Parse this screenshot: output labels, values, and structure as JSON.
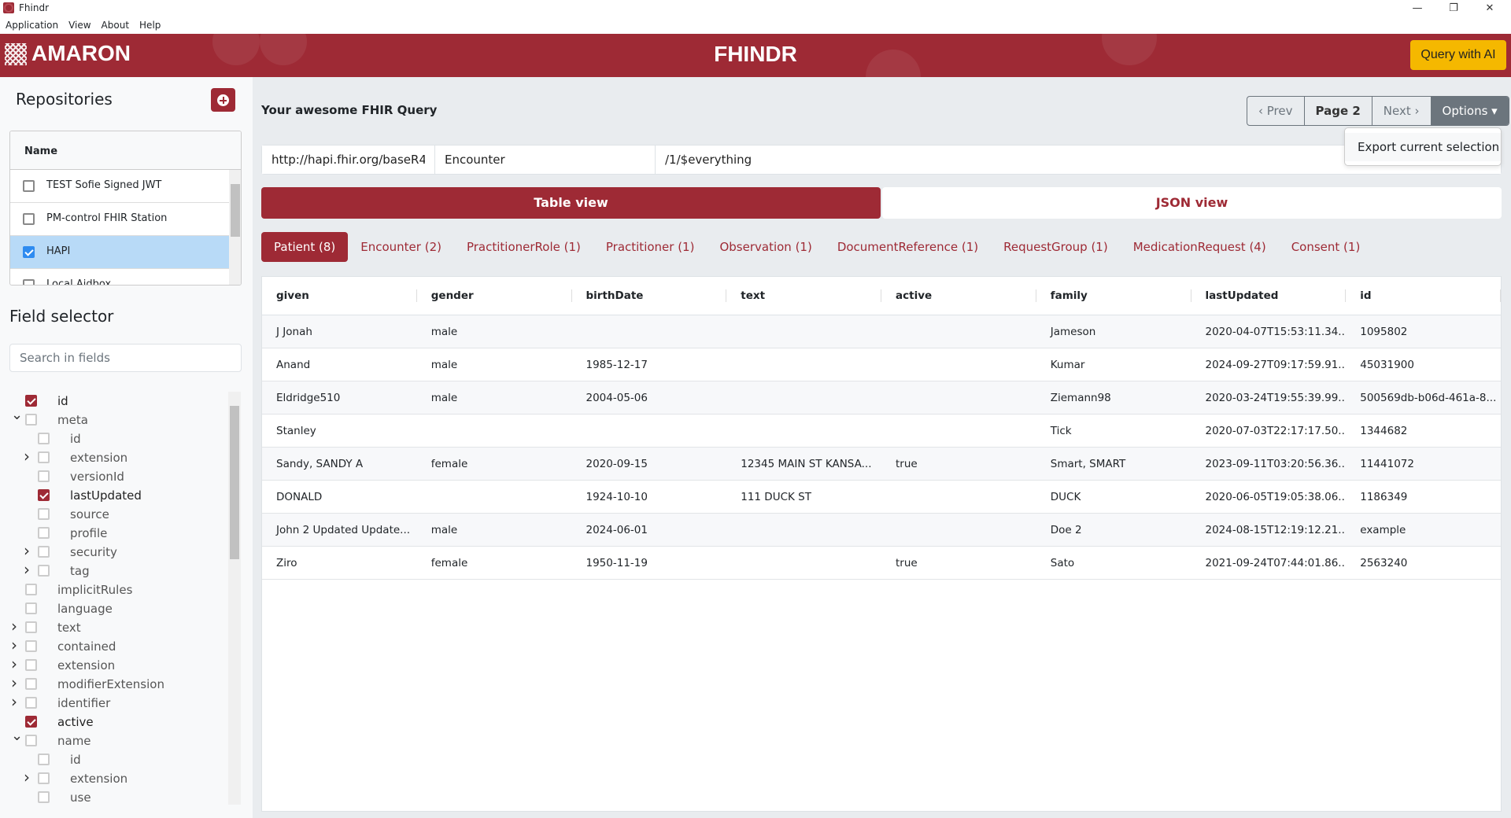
{
  "window": {
    "title": "Fhindr",
    "minimize": "—",
    "restore": "❐",
    "close": "✕"
  },
  "menu": [
    "Application",
    "View",
    "About",
    "Help"
  ],
  "header": {
    "brand": "AMARON",
    "title": "FHINDR",
    "ai_button": "Query with AI",
    "accent": "#9e2a35",
    "ai_color": "#f5b800"
  },
  "sidebar": {
    "repositories_title": "Repositories",
    "repo_column": "Name",
    "repos": [
      {
        "name": "TEST Sofie Signed JWT",
        "checked": false
      },
      {
        "name": "PM-control FHIR Station",
        "checked": false
      },
      {
        "name": "HAPI",
        "checked": true
      },
      {
        "name": "Local Aidbox",
        "checked": false
      }
    ],
    "field_selector_title": "Field selector",
    "search_placeholder": "Search in fields",
    "fields": [
      {
        "label": "id",
        "level": 0,
        "checked": true
      },
      {
        "label": "meta",
        "level": 0,
        "expand": "open"
      },
      {
        "label": "id",
        "level": 1
      },
      {
        "label": "extension",
        "level": 1,
        "expand": "closed"
      },
      {
        "label": "versionId",
        "level": 1
      },
      {
        "label": "lastUpdated",
        "level": 1,
        "checked": true
      },
      {
        "label": "source",
        "level": 1
      },
      {
        "label": "profile",
        "level": 1
      },
      {
        "label": "security",
        "level": 1,
        "expand": "closed"
      },
      {
        "label": "tag",
        "level": 1,
        "expand": "closed"
      },
      {
        "label": "implicitRules",
        "level": 0
      },
      {
        "label": "language",
        "level": 0
      },
      {
        "label": "text",
        "level": 0,
        "expand": "closed"
      },
      {
        "label": "contained",
        "level": 0,
        "expand": "closed"
      },
      {
        "label": "extension",
        "level": 0,
        "expand": "closed"
      },
      {
        "label": "modifierExtension",
        "level": 0,
        "expand": "closed"
      },
      {
        "label": "identifier",
        "level": 0,
        "expand": "closed"
      },
      {
        "label": "active",
        "level": 0,
        "checked": true
      },
      {
        "label": "name",
        "level": 0,
        "expand": "open"
      },
      {
        "label": "id",
        "level": 1
      },
      {
        "label": "extension",
        "level": 1,
        "expand": "closed"
      },
      {
        "label": "use",
        "level": 1
      }
    ]
  },
  "main": {
    "query_title": "Your awesome FHIR Query",
    "pager": {
      "prev": "‹ Prev",
      "page": "Page 2",
      "next": "Next ›",
      "options": "Options ▾"
    },
    "dropdown": {
      "export": "Export current selection"
    },
    "query": {
      "base": "http://hapi.fhir.org/baseR4/",
      "resource": "Encounter",
      "path": "/1/$everything"
    },
    "views": {
      "table": "Table view",
      "json": "JSON view"
    },
    "tabs": [
      "Patient (8)",
      "Encounter (2)",
      "PractitionerRole (1)",
      "Practitioner (1)",
      "Observation (1)",
      "DocumentReference (1)",
      "RequestGroup (1)",
      "MedicationRequest (4)",
      "Consent (1)"
    ],
    "columns": [
      "given",
      "gender",
      "birthDate",
      "text",
      "active",
      "family",
      "lastUpdated",
      "id"
    ],
    "rows": [
      [
        "J Jonah",
        "male",
        "",
        "",
        "",
        "Jameson",
        "2020-04-07T15:53:11.34...",
        "1095802"
      ],
      [
        "Anand",
        "male",
        "1985-12-17",
        "",
        "",
        "Kumar",
        "2024-09-27T09:17:59.91...",
        "45031900"
      ],
      [
        "Eldridge510",
        "male",
        "2004-05-06",
        "",
        "",
        "Ziemann98",
        "2020-03-24T19:55:39.99...",
        "500569db-b06d-461a-8..."
      ],
      [
        "Stanley",
        "",
        "",
        "",
        "",
        "Tick",
        "2020-07-03T22:17:17.50...",
        "1344682"
      ],
      [
        "Sandy, SANDY A",
        "female",
        "2020-09-15",
        "12345 MAIN ST KANSA...",
        "true",
        "Smart, SMART",
        "2023-09-11T03:20:56.36...",
        "11441072"
      ],
      [
        "DONALD",
        "",
        "1924-10-10",
        "111 DUCK ST",
        "",
        "DUCK",
        "2020-06-05T19:05:38.06...",
        "1186349"
      ],
      [
        "John 2 Updated Update...",
        "male",
        "2024-06-01",
        "",
        "",
        "Doe 2",
        "2024-08-15T12:19:12.21...",
        "example"
      ],
      [
        "Ziro",
        "female",
        "1950-11-19",
        "",
        "true",
        "Sato",
        "2021-09-24T07:44:01.86...",
        "2563240"
      ]
    ]
  }
}
